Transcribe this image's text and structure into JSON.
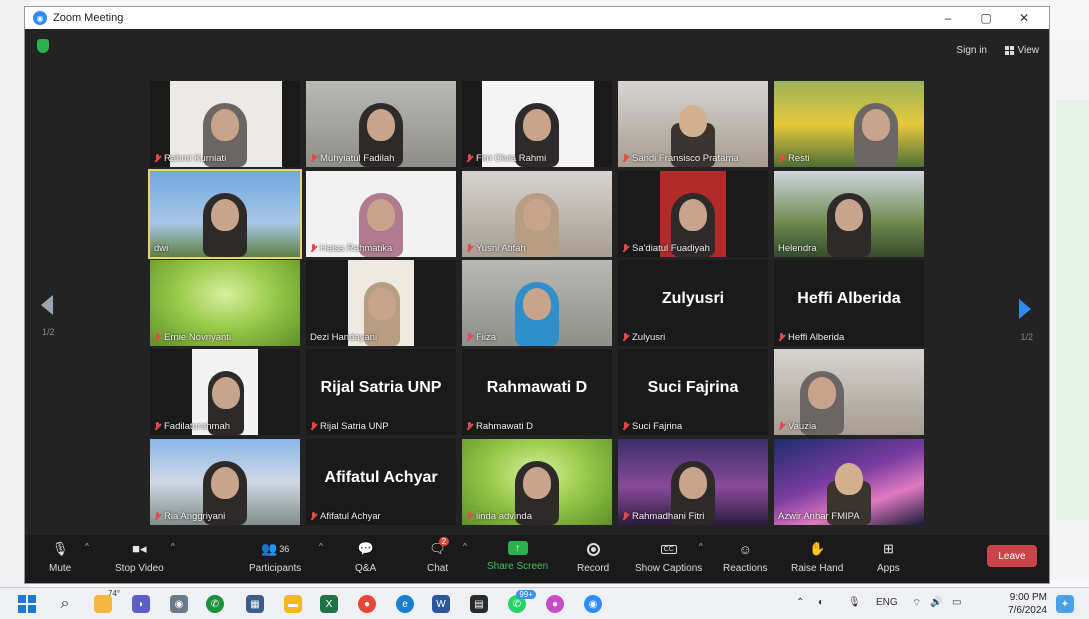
{
  "window": {
    "title": "Zoom Meeting",
    "controls": [
      "–",
      "▢",
      "✕"
    ]
  },
  "header": {
    "sign_in": "Sign in",
    "view": "View"
  },
  "pagination": {
    "left": "1/2",
    "right": "1/2"
  },
  "tiles": [
    {
      "name": "Rahmi Kurniati"
    },
    {
      "name": "Muhyiatul Fadilah"
    },
    {
      "name": "Fitri Olvia Rahmi"
    },
    {
      "name": "Sandi Fransisco Pratama"
    },
    {
      "name": "Resti"
    },
    {
      "name": "dwi"
    },
    {
      "name": "Helsa Rahmatika"
    },
    {
      "name": "Yusni Atifah"
    },
    {
      "name": "Sa'diatul Fuadiyah"
    },
    {
      "name": "Helendra"
    },
    {
      "name": "Ernie Novriyanti"
    },
    {
      "name": "Dezi Handayani"
    },
    {
      "name": "Fiiza"
    },
    {
      "name": "Zulyusri",
      "display": "Zulyusri"
    },
    {
      "name": "Heffi Alberida",
      "display": "Heffi Alberida"
    },
    {
      "name": "Fadilaturahmah"
    },
    {
      "name": "Rijal Satria UNP",
      "display": "Rijal Satria UNP"
    },
    {
      "name": "Rahmawati D",
      "display": "Rahmawati D"
    },
    {
      "name": "Suci Fajrina",
      "display": "Suci Fajrina"
    },
    {
      "name": "Vauzia"
    },
    {
      "name": "Ria Anggriyani"
    },
    {
      "name": "Afifatul Achyar",
      "display": "Afifatul Achyar"
    },
    {
      "name": "linda advinda"
    },
    {
      "name": "Rahmadhani Fitri"
    },
    {
      "name": "Azwir Anhar FMIPA"
    }
  ],
  "toolbar": {
    "mute": "Mute",
    "stop_video": "Stop Video",
    "participants": "Participants",
    "participants_count": "36",
    "qa": "Q&A",
    "chat": "Chat",
    "chat_badge": "2",
    "share_screen": "Share Screen",
    "record": "Record",
    "show_captions": "Show Captions",
    "cc": "CC",
    "reactions": "Reactions",
    "raise_hand": "Raise Hand",
    "apps": "Apps",
    "leave": "Leave"
  },
  "taskbar": {
    "weather_temp": "74°",
    "whatsapp_badge": "99+",
    "lang": "ENG",
    "time": "9:00 PM",
    "date": "7/6/2024"
  },
  "colors": {
    "accent": "#2d8cff",
    "share_green": "#2bb24c",
    "leave_red": "#c9454a",
    "active_speaker": "#e8d66a"
  }
}
